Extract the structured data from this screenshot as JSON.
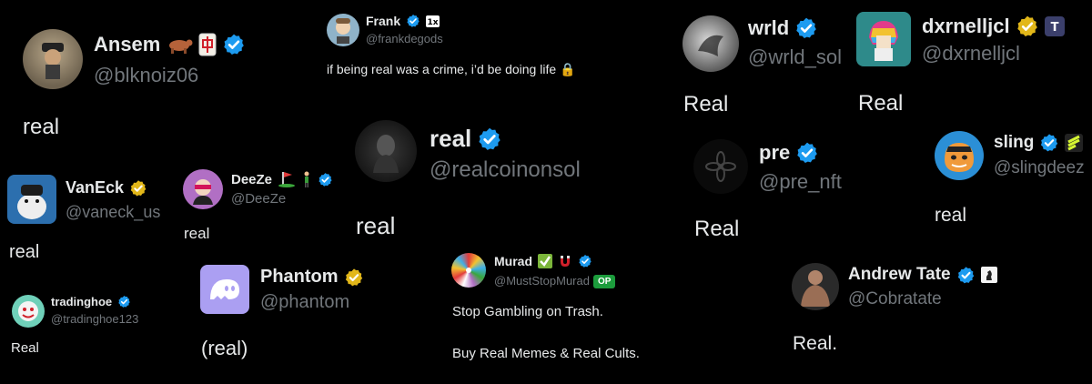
{
  "colors": {
    "background": "#000000",
    "text": "#e7e9ea",
    "handle": "#71767b",
    "verified_blue": "#1d9bf0",
    "verified_gold": "#e2b719"
  },
  "posts": [
    {
      "id": "ansem",
      "name": "Ansem",
      "handle": "@blknoiz06",
      "text": "real",
      "badge": "blue-check-icon",
      "emojis": [
        "ox-emoji",
        "mahjong-tile-emoji"
      ]
    },
    {
      "id": "frank",
      "name": "Frank",
      "handle": "@frankdegods",
      "text": "if being real was a crime, i’d be doing life 🔒",
      "badge": "blue-check-icon",
      "emojis": [
        "tag-icon"
      ]
    },
    {
      "id": "wrld",
      "name": "wrld",
      "handle": "@wrld_sol",
      "text": "Real",
      "badge": "blue-check-icon"
    },
    {
      "id": "dxrnelljcl",
      "name": "dxrnelljcl",
      "handle": "@dxrnelljcl",
      "text": "Real",
      "badge": "gold-check-icon",
      "emojis": [
        "t-badge-icon"
      ]
    },
    {
      "id": "realcoin",
      "name": "real",
      "handle": "@realcoinonsol",
      "text": "real",
      "badge": "blue-check-icon"
    },
    {
      "id": "pre",
      "name": "pre",
      "handle": "@pre_nft",
      "text": "Real",
      "badge": "blue-check-icon"
    },
    {
      "id": "sling",
      "name": "sling",
      "handle": "@slingdeez",
      "text": "real",
      "badge": "blue-check-icon",
      "emojis": [
        "lightning-badge-icon"
      ]
    },
    {
      "id": "vaneck",
      "name": "VanEck",
      "handle": "@vaneck_us",
      "text": "real",
      "badge": "gold-check-icon"
    },
    {
      "id": "deeze",
      "name": "DeeZe",
      "handle": "@DeeZe",
      "text": "real",
      "badge": "blue-check-icon",
      "emojis": [
        "golf-emoji",
        "golfer-emoji"
      ]
    },
    {
      "id": "phantom",
      "name": "Phantom",
      "handle": "@phantom",
      "text": "(real)",
      "badge": "gold-check-icon"
    },
    {
      "id": "murad",
      "name": "Murad",
      "handle": "@MustStopMurad",
      "op_label": "OP",
      "text_lines": [
        "Stop Gambling on Trash.",
        "Buy Real Memes & Real Cults."
      ],
      "badge": "blue-check-icon",
      "emojis": [
        "check-box-emoji",
        "magnet-emoji"
      ]
    },
    {
      "id": "tradinghoe",
      "name": "tradinghoe",
      "handle": "@tradinghoe123",
      "text": "Real",
      "badge": "blue-check-icon"
    },
    {
      "id": "andrewtate",
      "name": "Andrew Tate",
      "handle": "@Cobratate",
      "text": "Real.",
      "badge": "blue-check-icon",
      "emojis": [
        "chess-badge-icon"
      ]
    }
  ]
}
